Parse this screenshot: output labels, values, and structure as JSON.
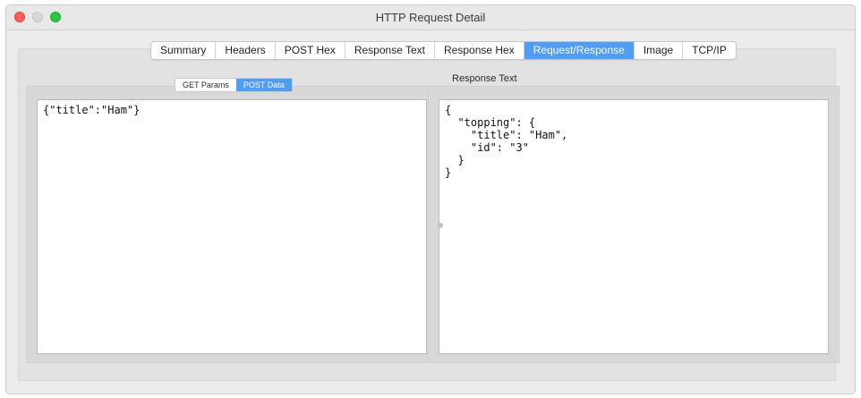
{
  "window": {
    "title": "HTTP Request Detail"
  },
  "tabs": [
    {
      "label": "Summary"
    },
    {
      "label": "Headers"
    },
    {
      "label": "POST Hex"
    },
    {
      "label": "Response Text"
    },
    {
      "label": "Response Hex"
    },
    {
      "label": "Request/Response"
    },
    {
      "label": "Image"
    },
    {
      "label": "TCP/IP"
    }
  ],
  "active_tab": "Request/Response",
  "request": {
    "subtabs": [
      {
        "label": "GET Params"
      },
      {
        "label": "POST Data"
      }
    ],
    "active_subtab": "POST Data",
    "body": "{\"title\":\"Ham\"}"
  },
  "response": {
    "label": "Response Text",
    "body": "{\n  \"topping\": {\n    \"title\": \"Ham\",\n    \"id\": \"3\"\n  }\n}"
  },
  "colors": {
    "accent": "#4f9df4",
    "close": "#fc5f57",
    "maximize": "#2ac840"
  }
}
